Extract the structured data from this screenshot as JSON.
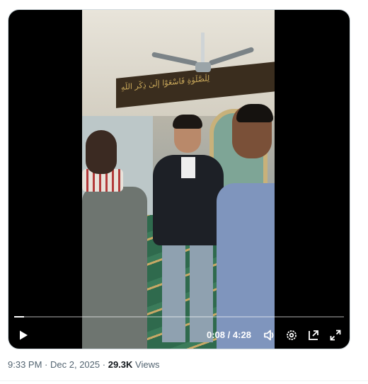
{
  "video": {
    "current_time": "0:08",
    "separator": "/",
    "duration": "4:28",
    "progress_fraction": 0.03,
    "banner_text": "لِلْصَّلَوٰةِ فَاسْعَوْا إِلَىٰ ذِكْرِ اللَّهِ"
  },
  "controls": {
    "play_icon": "play-icon",
    "volume_icon": "volume-icon",
    "settings_icon": "gear-icon",
    "pip_icon": "pip-icon",
    "fullscreen_icon": "fullscreen-icon"
  },
  "post_meta": {
    "time": "9:33 PM",
    "dot1": "·",
    "date": "Dec 2, 2025",
    "dot2": "·",
    "views_count": "29.3K",
    "views_label": "Views"
  },
  "colors": {
    "card_border": "#cfd9de",
    "meta_text": "#536471",
    "emphasis_text": "#0f1419"
  }
}
